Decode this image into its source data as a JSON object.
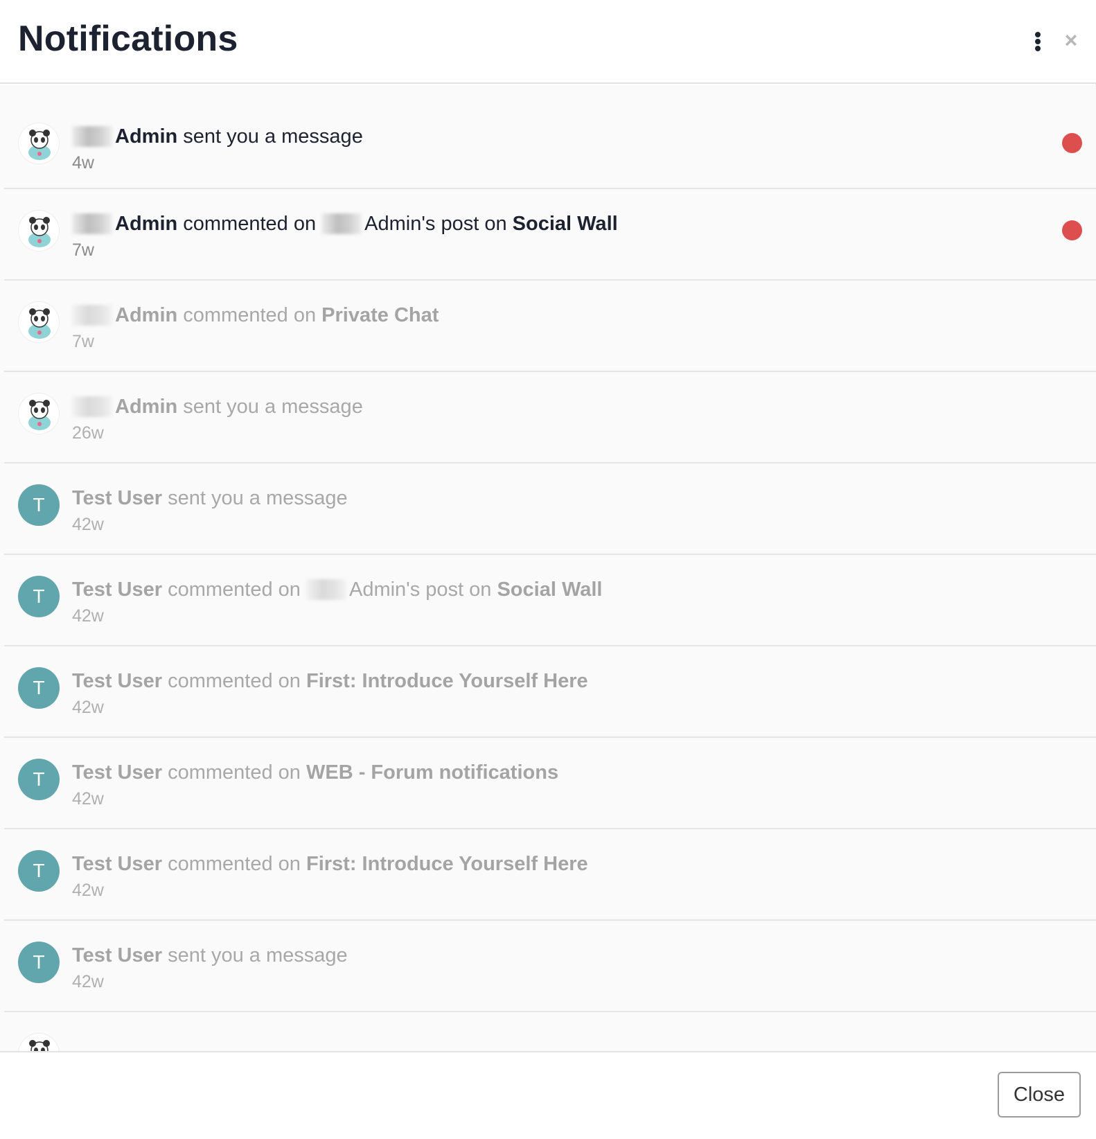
{
  "header": {
    "title": "Notifications",
    "menu_icon": "kebab-vertical-icon",
    "close_icon": "close-x-icon"
  },
  "notifications": [
    {
      "avatar": "panda",
      "actor": "Admin",
      "action": " sent you a message",
      "time": "4w",
      "unread": true
    },
    {
      "avatar": "panda",
      "actor": "Admin",
      "action": " commented on ",
      "target_owner": "Admin's post on ",
      "target": "Social Wall",
      "time": "7w",
      "unread": true
    },
    {
      "avatar": "panda",
      "actor": "Admin",
      "action": " commented on ",
      "target": "Private Chat",
      "time": "7w",
      "unread": false
    },
    {
      "avatar": "panda",
      "actor": "Admin",
      "action": " sent you a message",
      "time": "26w",
      "unread": false
    },
    {
      "avatar_letter": "T",
      "actor": "Test User",
      "action": " sent you a message",
      "time": "42w",
      "unread": false
    },
    {
      "avatar_letter": "T",
      "actor": "Test User",
      "action": " commented on ",
      "target_owner": "Admin's post on ",
      "target": "Social Wall",
      "time": "42w",
      "unread": false
    },
    {
      "avatar_letter": "T",
      "actor": "Test User",
      "action": " commented on ",
      "target": "First: Introduce Yourself Here",
      "time": "42w",
      "unread": false
    },
    {
      "avatar_letter": "T",
      "actor": "Test User",
      "action": " commented on ",
      "target": "WEB - Forum notifications",
      "time": "42w",
      "unread": false
    },
    {
      "avatar_letter": "T",
      "actor": "Test User",
      "action": " commented on ",
      "target": "First: Introduce Yourself Here",
      "time": "42w",
      "unread": false
    },
    {
      "avatar_letter": "T",
      "actor": "Test User",
      "action": " sent you a message",
      "time": "42w",
      "unread": false
    }
  ],
  "footer": {
    "close_label": "Close"
  },
  "colors": {
    "unread_dot": "#dd4e4e",
    "avatar_teal": "#62a6ad",
    "title": "#1c2230"
  }
}
